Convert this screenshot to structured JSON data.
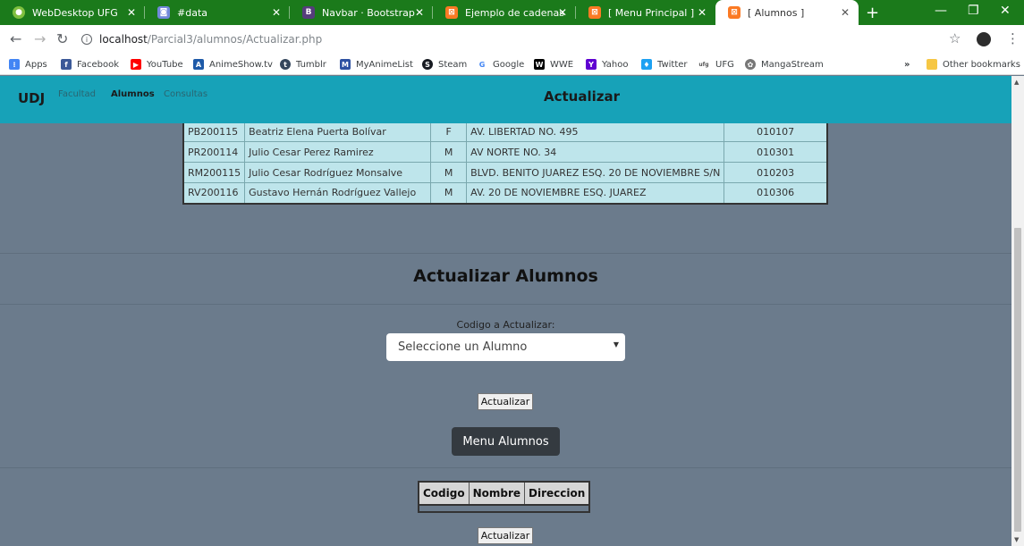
{
  "browser": {
    "tabs": [
      {
        "title": "WebDesktop UFG",
        "icon": "green-circle-icon",
        "color": "#7fbf3f"
      },
      {
        "title": "#data",
        "icon": "discord-icon",
        "color": "#7289da"
      },
      {
        "title": "Navbar · Bootstrap",
        "icon": "bootstrap-icon",
        "color": "#563d7c"
      },
      {
        "title": "Ejemplo de cadenas en",
        "icon": "xampp-icon",
        "color": "#fb7a24"
      },
      {
        "title": "[ Menu Principal ]",
        "icon": "xampp-icon",
        "color": "#fb7a24"
      },
      {
        "title": "[ Alumnos ]",
        "icon": "xampp-icon",
        "color": "#fb7a24"
      }
    ],
    "url_host": "localhost",
    "url_path": "/Parcial3/alumnos/Actualizar.php",
    "bookmarks": [
      {
        "label": "Apps",
        "icon": "apps-grid-icon",
        "color": "#4285f4"
      },
      {
        "label": "Facebook",
        "icon": "facebook-icon",
        "color": "#3b5998"
      },
      {
        "label": "YouTube",
        "icon": "youtube-icon",
        "color": "#ff0000"
      },
      {
        "label": "AnimeShow.tv",
        "icon": "animeshow-icon",
        "color": "#1e5aa8"
      },
      {
        "label": "Tumblr",
        "icon": "tumblr-icon",
        "color": "#35465c"
      },
      {
        "label": "MyAnimeList",
        "icon": "myanimelist-icon",
        "color": "#2e51a2"
      },
      {
        "label": "Steam",
        "icon": "steam-icon",
        "color": "#171a21"
      },
      {
        "label": "Google",
        "icon": "google-icon",
        "color": "#4285f4"
      },
      {
        "label": "WWE",
        "icon": "wwe-icon",
        "color": "#000000"
      },
      {
        "label": "Yahoo",
        "icon": "yahoo-icon",
        "color": "#5f01d1"
      },
      {
        "label": "Twitter",
        "icon": "twitter-icon",
        "color": "#1da1f2"
      },
      {
        "label": "UFG",
        "icon": "ufg-icon",
        "color": "#555555"
      },
      {
        "label": "MangaStream",
        "icon": "mangastream-icon",
        "color": "#777777"
      }
    ],
    "more_bookmarks": "»",
    "other_bookmarks": "Other bookmarks"
  },
  "navbar": {
    "brand": "UDJ",
    "links": [
      "Facultad",
      "Alumnos",
      "Consultas"
    ],
    "active_link": "Alumnos",
    "title": "Actualizar",
    "color": "#17a2b8"
  },
  "students_table": {
    "rows": [
      {
        "codigo": "PB200115",
        "nombre": "Beatriz Elena Puerta Bolívar",
        "sexo": "F",
        "direccion": "AV. LIBERTAD NO. 495",
        "cp": "010107"
      },
      {
        "codigo": "PR200114",
        "nombre": "Julio Cesar Perez Ramirez",
        "sexo": "M",
        "direccion": "AV NORTE NO. 34",
        "cp": "010301"
      },
      {
        "codigo": "RM200115",
        "nombre": "Julio Cesar Rodríguez Monsalve",
        "sexo": "M",
        "direccion": "BLVD. BENITO JUAREZ ESQ. 20 DE NOVIEMBRE S/N",
        "cp": "010203"
      },
      {
        "codigo": "RV200116",
        "nombre": "Gustavo Hernán Rodríguez Vallejo",
        "sexo": "M",
        "direccion": "AV. 20 DE NOVIEMBRE ESQ. JUAREZ",
        "cp": "010306"
      }
    ]
  },
  "update_section": {
    "title": "Actualizar Alumnos",
    "select_label": "Codigo a Actualizar:",
    "select_value": "Seleccione un Alumno",
    "update_button": "Actualizar",
    "menu_button": "Menu Alumnos"
  },
  "result_table": {
    "headers": [
      "Codigo",
      "Nombre",
      "Direccion"
    ],
    "update_button": "Actualizar"
  }
}
